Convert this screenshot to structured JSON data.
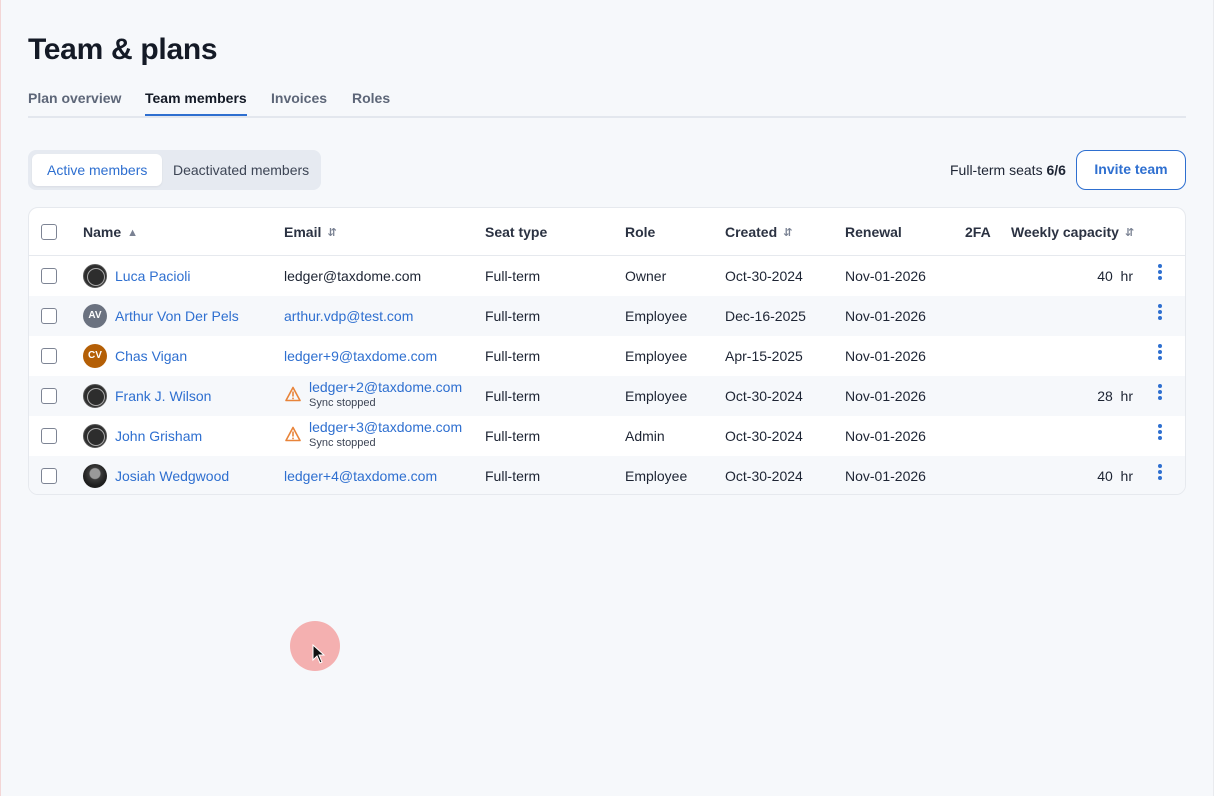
{
  "page": {
    "title": "Team & plans"
  },
  "tabs": [
    {
      "label": "Plan overview",
      "active": false
    },
    {
      "label": "Team members",
      "active": true
    },
    {
      "label": "Invoices",
      "active": false
    },
    {
      "label": "Roles",
      "active": false
    }
  ],
  "segmented": {
    "active_label": "Active members",
    "deactivated_label": "Deactivated members"
  },
  "seats": {
    "label": "Full-term seats",
    "value": "6/6"
  },
  "invite_label": "Invite team",
  "columns": {
    "name": "Name",
    "email": "Email",
    "seat_type": "Seat type",
    "role": "Role",
    "created": "Created",
    "renewal": "Renewal",
    "twofa": "2FA",
    "capacity": "Weekly capacity"
  },
  "members": [
    {
      "name": "Luca Pacioli",
      "avatar": "logo",
      "email": "ledger@taxdome.com",
      "email_link": false,
      "sync_status": "",
      "seat_type": "Full-term",
      "role": "Owner",
      "created": "Oct-30-2024",
      "renewal": "Nov-01-2026",
      "capacity": "40",
      "capacity_unit": "hr"
    },
    {
      "name": "Arthur Von Der Pels",
      "avatar": "initials",
      "initials": "AV",
      "avatar_color": "#6b7280",
      "email": "arthur.vdp@test.com",
      "email_link": true,
      "sync_status": "",
      "seat_type": "Full-term",
      "role": "Employee",
      "created": "Dec-16-2025",
      "renewal": "Nov-01-2026",
      "capacity": "",
      "capacity_unit": ""
    },
    {
      "name": "Chas Vigan",
      "avatar": "initials",
      "initials": "CV",
      "avatar_color": "#b45f06",
      "email": "ledger+9@taxdome.com",
      "email_link": true,
      "sync_status": "",
      "seat_type": "Full-term",
      "role": "Employee",
      "created": "Apr-15-2025",
      "renewal": "Nov-01-2026",
      "capacity": "",
      "capacity_unit": ""
    },
    {
      "name": "Frank J. Wilson",
      "avatar": "logo",
      "email": "ledger+2@taxdome.com",
      "email_link": true,
      "sync_status": "Sync stopped",
      "seat_type": "Full-term",
      "role": "Employee",
      "created": "Oct-30-2024",
      "renewal": "Nov-01-2026",
      "capacity": "28",
      "capacity_unit": "hr"
    },
    {
      "name": "John Grisham",
      "avatar": "logo",
      "email": "ledger+3@taxdome.com",
      "email_link": true,
      "sync_status": "Sync stopped",
      "seat_type": "Full-term",
      "role": "Admin",
      "created": "Oct-30-2024",
      "renewal": "Nov-01-2026",
      "capacity": "",
      "capacity_unit": ""
    },
    {
      "name": "Josiah Wedgwood",
      "avatar": "photo",
      "email": "ledger+4@taxdome.com",
      "email_link": true,
      "sync_status": "",
      "seat_type": "Full-term",
      "role": "Employee",
      "created": "Oct-30-2024",
      "renewal": "Nov-01-2026",
      "capacity": "40",
      "capacity_unit": "hr"
    }
  ],
  "colors": {
    "accent": "#2e6fd0",
    "warning": "#e8843a",
    "background": "#f6f8fb"
  },
  "icons": {
    "sort": "sort-icon",
    "warning": "warning-icon",
    "row_menu": "kebab-menu-icon",
    "cursor": "mouse-cursor-icon"
  }
}
